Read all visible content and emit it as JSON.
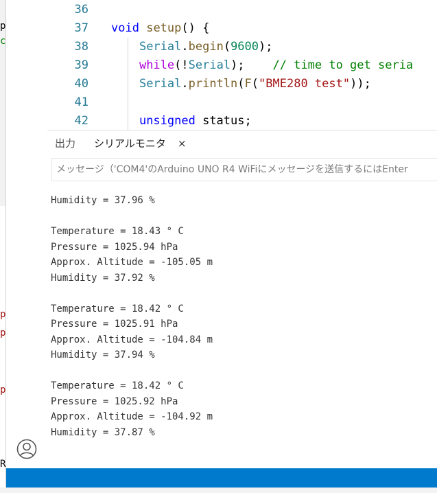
{
  "editor": {
    "lines": [
      {
        "number": "36",
        "tokens": []
      },
      {
        "number": "37",
        "tokens": [
          {
            "t": "void",
            "c": "kw"
          },
          {
            "t": " ",
            "c": ""
          },
          {
            "t": "setup",
            "c": "fn"
          },
          {
            "t": "() {",
            "c": ""
          }
        ]
      },
      {
        "number": "38",
        "tokens": [
          {
            "t": "    ",
            "c": ""
          },
          {
            "t": "Serial",
            "c": "obj"
          },
          {
            "t": ".",
            "c": ""
          },
          {
            "t": "begin",
            "c": "fn"
          },
          {
            "t": "(",
            "c": ""
          },
          {
            "t": "9600",
            "c": "num"
          },
          {
            "t": ");",
            "c": ""
          }
        ]
      },
      {
        "number": "39",
        "tokens": [
          {
            "t": "    ",
            "c": ""
          },
          {
            "t": "while",
            "c": "ctrl"
          },
          {
            "t": "(!",
            "c": ""
          },
          {
            "t": "Serial",
            "c": "obj"
          },
          {
            "t": ");    ",
            "c": ""
          },
          {
            "t": "// time to get seria",
            "c": "cmt"
          }
        ]
      },
      {
        "number": "40",
        "tokens": [
          {
            "t": "    ",
            "c": ""
          },
          {
            "t": "Serial",
            "c": "obj"
          },
          {
            "t": ".",
            "c": ""
          },
          {
            "t": "println",
            "c": "fn"
          },
          {
            "t": "(",
            "c": ""
          },
          {
            "t": "F",
            "c": "fn"
          },
          {
            "t": "(",
            "c": ""
          },
          {
            "t": "\"BME280 test\"",
            "c": "str"
          },
          {
            "t": "));",
            "c": ""
          }
        ]
      },
      {
        "number": "41",
        "tokens": []
      },
      {
        "number": "42",
        "tokens": [
          {
            "t": "    ",
            "c": ""
          },
          {
            "t": "unsigned",
            "c": "kw"
          },
          {
            "t": " status;",
            "c": ""
          }
        ]
      }
    ]
  },
  "panel": {
    "tab_output": "出力",
    "tab_serial": "シリアルモニタ",
    "tab_close": "×"
  },
  "serial": {
    "placeholder": "メッセージ（'COM4'のArduino UNO R4 WiFiにメッセージを送信するにはEnter",
    "lines": [
      "Humidity = 37.96 %",
      "",
      "Temperature = 18.43 ° C",
      "Pressure = 1025.94 hPa",
      "Approx. Altitude = -105.05 m",
      "Humidity = 37.92 %",
      "",
      "Temperature = 18.42 ° C",
      "Pressure = 1025.91 hPa",
      "Approx. Altitude = -104.84 m",
      "Humidity = 37.94 %",
      "",
      "Temperature = 18.42 ° C",
      "Pressure = 1025.92 hPa",
      "Approx. Altitude = -104.92 m",
      "Humidity = 37.87 %"
    ]
  },
  "left_strip": {
    "glyphs": [
      {
        "ch": "p",
        "color": "#000000"
      },
      {
        "ch": "c",
        "color": "#008000"
      },
      {
        "ch": "p",
        "color": "#a31515"
      },
      {
        "ch": "p",
        "color": "#a31515"
      },
      {
        "ch": "p",
        "color": "#a31515"
      },
      {
        "ch": "R",
        "color": "#000000"
      }
    ]
  },
  "colors": {
    "statusbar": "#007acc",
    "line_number": "#237893",
    "keyword": "#0000ff"
  },
  "icons": {
    "account": "account-icon"
  }
}
